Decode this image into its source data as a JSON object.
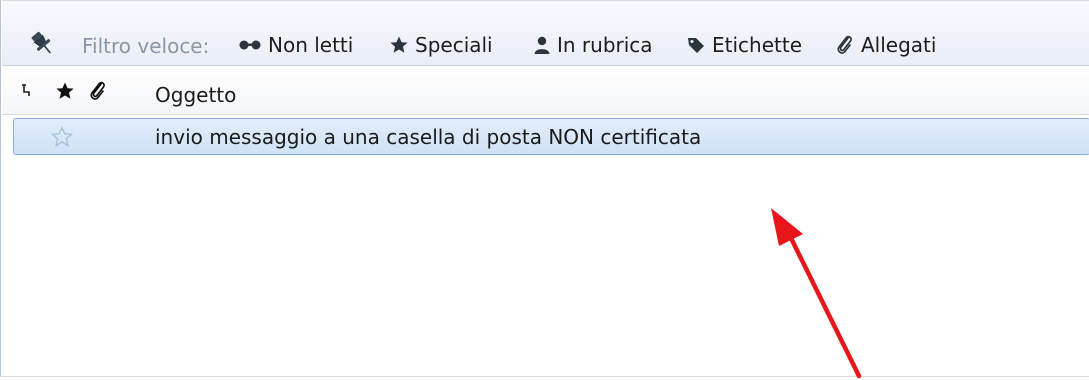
{
  "quick_filter": {
    "label": "Filtro veloce:",
    "buttons": [
      {
        "label": "Non letti",
        "icon": "glasses-icon"
      },
      {
        "label": "Speciali",
        "icon": "star-icon"
      },
      {
        "label": "In rubrica",
        "icon": "contact-icon"
      },
      {
        "label": "Etichette",
        "icon": "tag-icon"
      },
      {
        "label": "Allegati",
        "icon": "paperclip-icon"
      }
    ]
  },
  "columns": {
    "thread_icon": "thread-icon",
    "star_icon": "star-icon",
    "attachment_icon": "paperclip-icon",
    "subject_label": "Oggetto"
  },
  "messages": [
    {
      "subject": "invio messaggio a una casella di posta NON certificata",
      "starred": false,
      "selected": true
    }
  ],
  "annotation": {
    "color": "#e8161a"
  },
  "colors": {
    "selection": "#cfe2f6",
    "selection_border": "#87aedc",
    "filter_label": "#8a96a6"
  }
}
